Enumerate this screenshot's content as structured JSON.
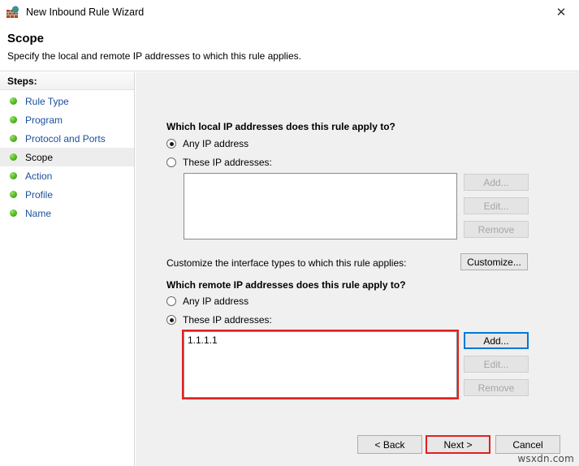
{
  "window": {
    "title": "New Inbound Rule Wizard",
    "icon": "firewall-brickwall-globe-icon",
    "close_label": "✕"
  },
  "header": {
    "title": "Scope",
    "subtitle": "Specify the local and remote IP addresses to which this rule applies."
  },
  "sidebar": {
    "heading": "Steps:",
    "items": [
      {
        "label": "Rule Type",
        "current": false
      },
      {
        "label": "Program",
        "current": false
      },
      {
        "label": "Protocol and Ports",
        "current": false
      },
      {
        "label": "Scope",
        "current": true
      },
      {
        "label": "Action",
        "current": false
      },
      {
        "label": "Profile",
        "current": false
      },
      {
        "label": "Name",
        "current": false
      }
    ]
  },
  "main": {
    "local": {
      "question": "Which local IP addresses does this rule apply to?",
      "radio_any": "Any IP address",
      "radio_these": "These IP addresses:",
      "selected": "any",
      "list_items": [],
      "buttons": {
        "add": "Add...",
        "edit": "Edit...",
        "remove": "Remove"
      }
    },
    "interface": {
      "label": "Customize the interface types to which this rule applies:",
      "button": "Customize..."
    },
    "remote": {
      "question": "Which remote IP addresses does this rule apply to?",
      "radio_any": "Any IP address",
      "radio_these": "These IP addresses:",
      "selected": "these",
      "list_items": [
        "1.1.1.1"
      ],
      "buttons": {
        "add": "Add...",
        "edit": "Edit...",
        "remove": "Remove"
      }
    }
  },
  "footer": {
    "back": "< Back",
    "next": "Next >",
    "cancel": "Cancel"
  },
  "watermark": "wsxdn.com",
  "colors": {
    "highlight_red": "#e02020",
    "focus_blue": "#0078d7",
    "link_blue": "#1b4f9c",
    "panel_gray": "#f0f0f0",
    "step_bullet_green": "#5cc02a"
  }
}
